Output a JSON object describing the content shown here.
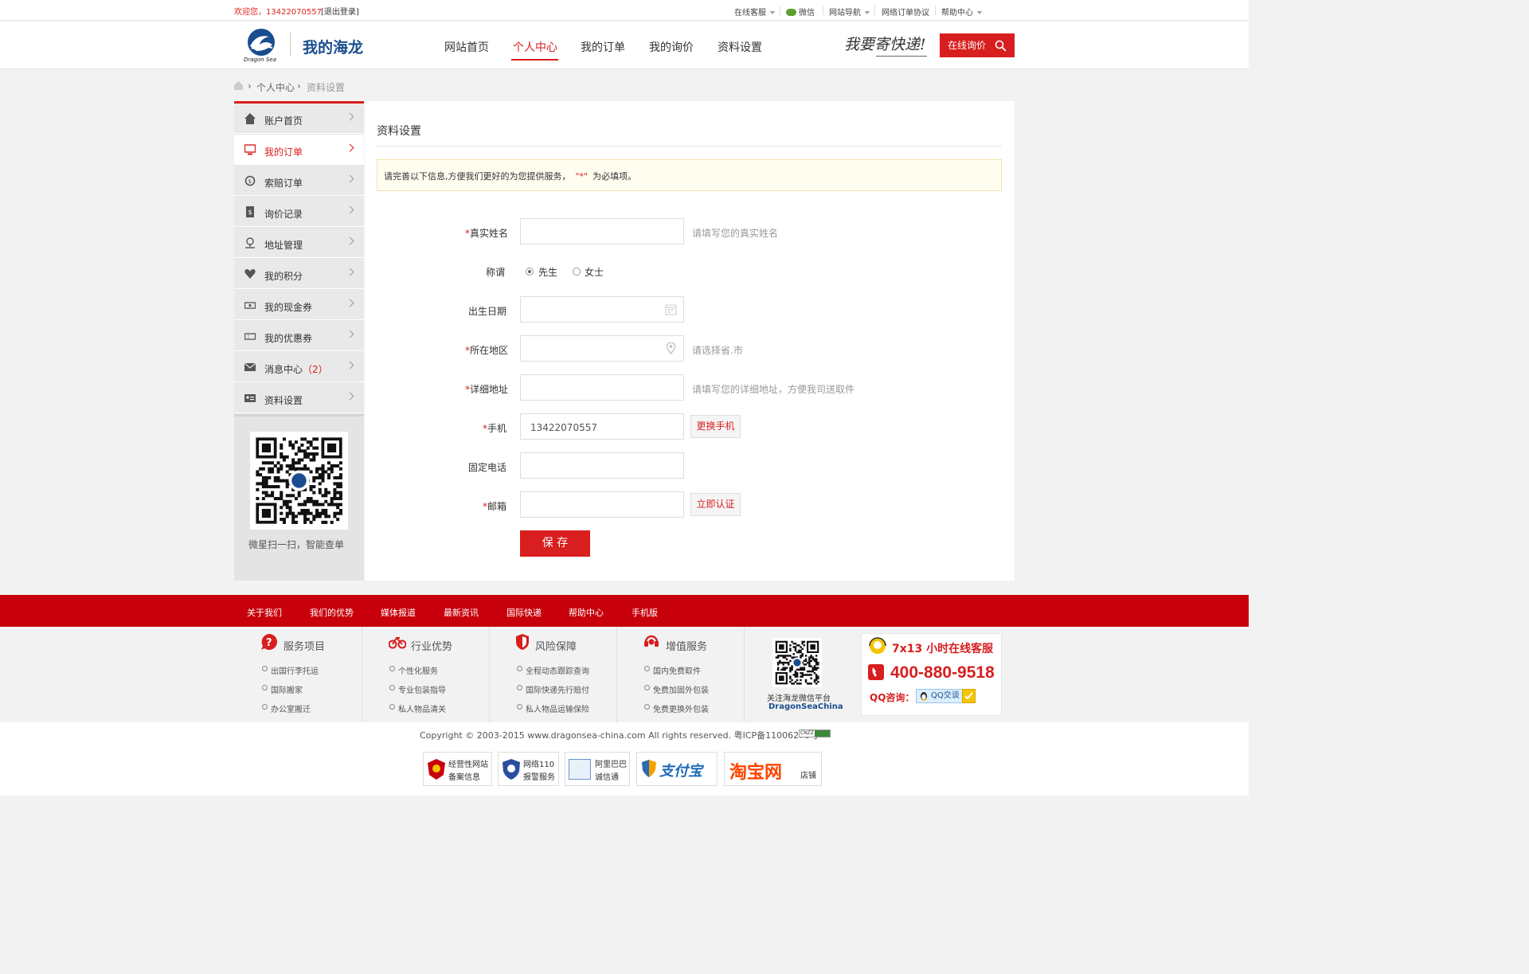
{
  "topbar": {
    "welcome": "欢迎您，13422070557",
    "logout": "[退出登录]",
    "links": [
      "在线客服",
      "微信",
      "网站导航",
      "网络订单协议",
      "帮助中心"
    ]
  },
  "header": {
    "logo_text": "我的海龙",
    "logo_sub": "Dragon Sea",
    "nav": [
      "网站首页",
      "个人中心",
      "我的订单",
      "我的询价",
      "资料设置"
    ],
    "slogan": "我要寄快递!",
    "quote_button": "在线询价"
  },
  "breadcrumb": [
    "个人中心",
    "资料设置"
  ],
  "sidebar": {
    "items": [
      {
        "label": "账户首页",
        "icon": "home-icon"
      },
      {
        "label": "我的订单",
        "icon": "monitor-icon"
      },
      {
        "label": "索赔订单",
        "icon": "refund-icon"
      },
      {
        "label": "询价记录",
        "icon": "dollar-doc-icon"
      },
      {
        "label": "地址管理",
        "icon": "location-icon"
      },
      {
        "label": "我的积分",
        "icon": "heart-icon"
      },
      {
        "label": "我的现金券",
        "icon": "cash-icon"
      },
      {
        "label": "我的优惠券",
        "icon": "coupon-icon"
      },
      {
        "label": "消息中心",
        "icon": "mail-icon"
      },
      {
        "label": "资料设置",
        "icon": "id-card-icon"
      }
    ],
    "message_count": "（2）",
    "qr_caption": "微星扫一扫，智能查单"
  },
  "main": {
    "title": "资料设置",
    "notice_prefix": "请完善以下信息,方便我们更好的为您提供服务，",
    "notice_star": "\"*\"",
    "notice_suffix": "为必填项。",
    "fields": {
      "name_label": "真实姓名",
      "name_hint": "请填写您的真实姓名",
      "title_label": "称谓",
      "title_options": [
        "先生",
        "女士"
      ],
      "birth_label": "出生日期",
      "region_label": "所在地区",
      "region_hint": "请选择省.市",
      "address_label": "详细地址",
      "address_hint": "请填写您的详细地址，方便我司送取件",
      "phone_label": "手机",
      "phone_value": "13422070557",
      "phone_button": "更换手机",
      "tel_label": "固定电话",
      "email_label": "邮箱",
      "email_button": "立即认证",
      "required_mark": "*"
    },
    "save_button": "保 存"
  },
  "footer_nav": [
    "关于我们",
    "我们的优势",
    "媒体报道",
    "最新资讯",
    "国际快递",
    "帮助中心",
    "手机版"
  ],
  "footer_services": [
    {
      "title": "服务项目",
      "items": [
        "出国行李托运",
        "国际搬家",
        "办公室搬迁"
      ]
    },
    {
      "title": "行业优势",
      "items": [
        "个性化服务",
        "专业包装指导",
        "私人物品清关"
      ]
    },
    {
      "title": "风险保障",
      "items": [
        "全程动态跟踪查询",
        "国际快递先行赔付",
        "私人物品运输保险"
      ]
    },
    {
      "title": "增值服务",
      "items": [
        "国内免费取件",
        "免费加固外包装",
        "免费更换外包装"
      ]
    }
  ],
  "wechat": {
    "line1": "关注海龙微信平台",
    "line2": "DragonSeaChina"
  },
  "hotline": {
    "title": "7x13 小时在线客服",
    "phone": "400-880-9518",
    "qq_label": "QQ咨询：",
    "qq_button": "QQ交谈"
  },
  "copyright": "Copyright © 2003-2015  www.dragonsea-china.com All rights reserved. 粤ICP备11006270号",
  "cnzz": "CNZZ",
  "badges": [
    {
      "line1": "经营性网站",
      "line2": "备案信息"
    },
    {
      "line1": "网络110",
      "line2": "报警服务"
    },
    {
      "line1": "阿里巴巴",
      "line2": "诚信通"
    },
    {
      "line1": "支付宝"
    },
    {
      "line1": "淘宝网",
      "line2": "店铺"
    }
  ],
  "colors": {
    "brand_red": "#d81e1e",
    "footer_red": "#c8000b"
  }
}
